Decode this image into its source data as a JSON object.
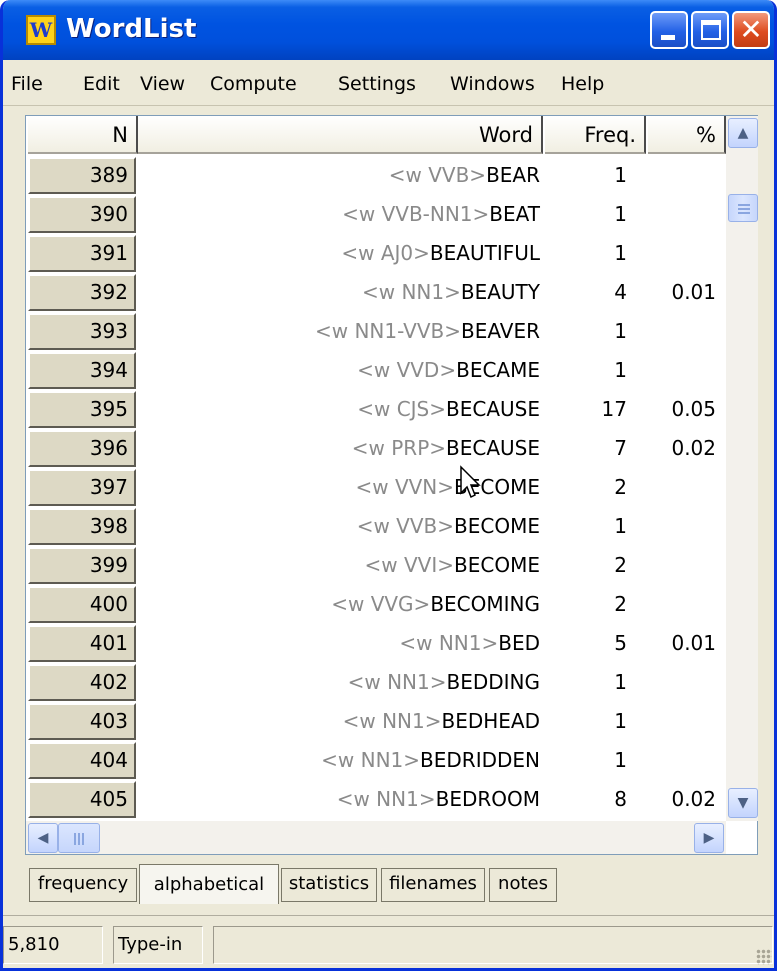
{
  "window": {
    "title": "WordList",
    "app_icon_glyph": "W",
    "minimize_icon": "minimize-icon",
    "maximize_icon": "maximize-icon",
    "close_icon": "close-icon"
  },
  "menu": {
    "items": [
      {
        "label": "File"
      },
      {
        "label": "Edit"
      },
      {
        "label": "View"
      },
      {
        "label": "Compute"
      },
      {
        "label": "Settings"
      },
      {
        "label": "Windows"
      },
      {
        "label": "Help"
      }
    ]
  },
  "table": {
    "columns": [
      {
        "key": "n",
        "label": "N"
      },
      {
        "key": "word",
        "label": "Word"
      },
      {
        "key": "freq",
        "label": "Freq."
      },
      {
        "key": "pct",
        "label": "%"
      }
    ],
    "rows": [
      {
        "n": "389",
        "tag": "<w VVB>",
        "word": "BEAR",
        "freq": "1",
        "pct": ""
      },
      {
        "n": "390",
        "tag": "<w VVB-NN1>",
        "word": "BEAT",
        "freq": "1",
        "pct": ""
      },
      {
        "n": "391",
        "tag": "<w AJ0>",
        "word": "BEAUTIFUL",
        "freq": "1",
        "pct": ""
      },
      {
        "n": "392",
        "tag": "<w NN1>",
        "word": "BEAUTY",
        "freq": "4",
        "pct": "0.01"
      },
      {
        "n": "393",
        "tag": "<w NN1-VVB>",
        "word": "BEAVER",
        "freq": "1",
        "pct": ""
      },
      {
        "n": "394",
        "tag": "<w VVD>",
        "word": "BECAME",
        "freq": "1",
        "pct": ""
      },
      {
        "n": "395",
        "tag": "<w CJS>",
        "word": "BECAUSE",
        "freq": "17",
        "pct": "0.05"
      },
      {
        "n": "396",
        "tag": "<w PRP>",
        "word": "BECAUSE",
        "freq": "7",
        "pct": "0.02"
      },
      {
        "n": "397",
        "tag": "<w VVN>",
        "word": "BECOME",
        "freq": "2",
        "pct": ""
      },
      {
        "n": "398",
        "tag": "<w VVB>",
        "word": "BECOME",
        "freq": "1",
        "pct": ""
      },
      {
        "n": "399",
        "tag": "<w VVI>",
        "word": "BECOME",
        "freq": "2",
        "pct": ""
      },
      {
        "n": "400",
        "tag": "<w VVG>",
        "word": "BECOMING",
        "freq": "2",
        "pct": ""
      },
      {
        "n": "401",
        "tag": "<w NN1>",
        "word": "BED",
        "freq": "5",
        "pct": "0.01"
      },
      {
        "n": "402",
        "tag": "<w NN1>",
        "word": "BEDDING",
        "freq": "1",
        "pct": ""
      },
      {
        "n": "403",
        "tag": "<w NN1>",
        "word": "BEDHEAD",
        "freq": "1",
        "pct": ""
      },
      {
        "n": "404",
        "tag": "<w NN1>",
        "word": "BEDRIDDEN",
        "freq": "1",
        "pct": ""
      },
      {
        "n": "405",
        "tag": "<w NN1>",
        "word": "BEDROOM",
        "freq": "8",
        "pct": "0.02"
      }
    ]
  },
  "scrollbars": {
    "up_icon": "scroll-up-arrow-icon",
    "down_icon": "scroll-down-arrow-icon",
    "left_icon": "scroll-left-arrow-icon",
    "right_icon": "scroll-right-arrow-icon"
  },
  "tabs": [
    {
      "label": "frequency",
      "active": false
    },
    {
      "label": "alphabetical",
      "active": true
    },
    {
      "label": "statistics",
      "active": false
    },
    {
      "label": "filenames",
      "active": false
    },
    {
      "label": "notes",
      "active": false
    }
  ],
  "status": {
    "count": "5,810",
    "mode": "Type-in"
  },
  "colors": {
    "title_bar": "#0053e1",
    "tag_text": "#8a8a8a",
    "word_text": "#000000",
    "row_header_bg": "#ddd9c5",
    "close_button": "#de4c20"
  }
}
